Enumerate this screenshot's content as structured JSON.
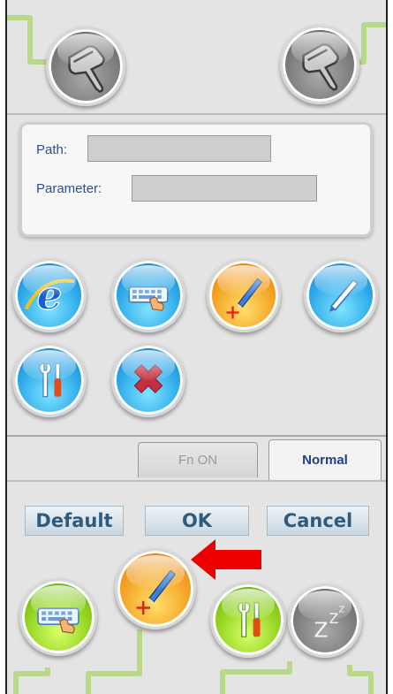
{
  "path_panel": {
    "path_label": "Path:",
    "path_value": "",
    "parameter_label": "Parameter:",
    "parameter_value": ""
  },
  "tabs": [
    {
      "label": "Fn ON",
      "selected": false
    },
    {
      "label": "Normal",
      "selected": true
    }
  ],
  "actions": {
    "default_label": "Default",
    "ok_label": "OK",
    "cancel_label": "Cancel"
  },
  "icons": {
    "top": [
      "scanner-icon",
      "scanner-icon"
    ],
    "grid": [
      "browser-icon",
      "keyboard-touch-icon",
      "pen-target-icon",
      "pen-icon",
      "tools-icon",
      "delete-icon"
    ],
    "bottom": [
      "keyboard-touch-icon",
      "pen-target-icon",
      "tools-icon",
      "sleep-icon"
    ]
  },
  "sleep_glyph": "Z",
  "colors": {
    "background": "#e4e4e4",
    "connector": "#b9d88a",
    "label_blue": "#2a4f9a",
    "arrow": "#ee0000"
  }
}
